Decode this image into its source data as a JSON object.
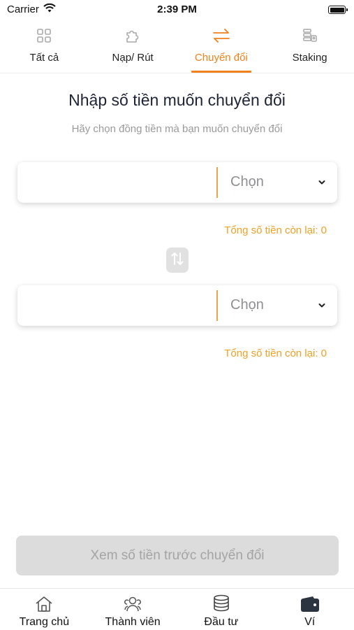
{
  "status_bar": {
    "carrier": "Carrier",
    "time": "2:39 PM"
  },
  "tabs": [
    {
      "label": "Tất cả",
      "icon": "grid-icon"
    },
    {
      "label": "Nạp/ Rút",
      "icon": "puzzle-icon"
    },
    {
      "label": "Chuyển đổi",
      "icon": "swap-arrows-icon",
      "active": true
    },
    {
      "label": "Staking",
      "icon": "staking-icon"
    }
  ],
  "main": {
    "title": "Nhập số tiền muốn chuyển đổi",
    "subtitle": "Hãy chọn đồng tiền mà bạn muốn chuyển đổi",
    "from": {
      "amount": "",
      "select_label": "Chọn",
      "remaining": "Tổng số tiền còn lại: 0"
    },
    "to": {
      "amount": "",
      "select_label": "Chọn",
      "remaining": "Tổng số tiền còn lại: 0"
    },
    "preview_button": "Xem số tiền trước chuyển đổi"
  },
  "bottom_nav": [
    {
      "label": "Trang chủ",
      "icon": "home-icon"
    },
    {
      "label": "Thành viên",
      "icon": "members-icon"
    },
    {
      "label": "Đầu tư",
      "icon": "coins-icon"
    },
    {
      "label": "Ví",
      "icon": "wallet-icon"
    }
  ],
  "colors": {
    "accent": "#f0811c",
    "remaining_text": "#f0a026",
    "disabled_button": "#dcdcdc"
  }
}
